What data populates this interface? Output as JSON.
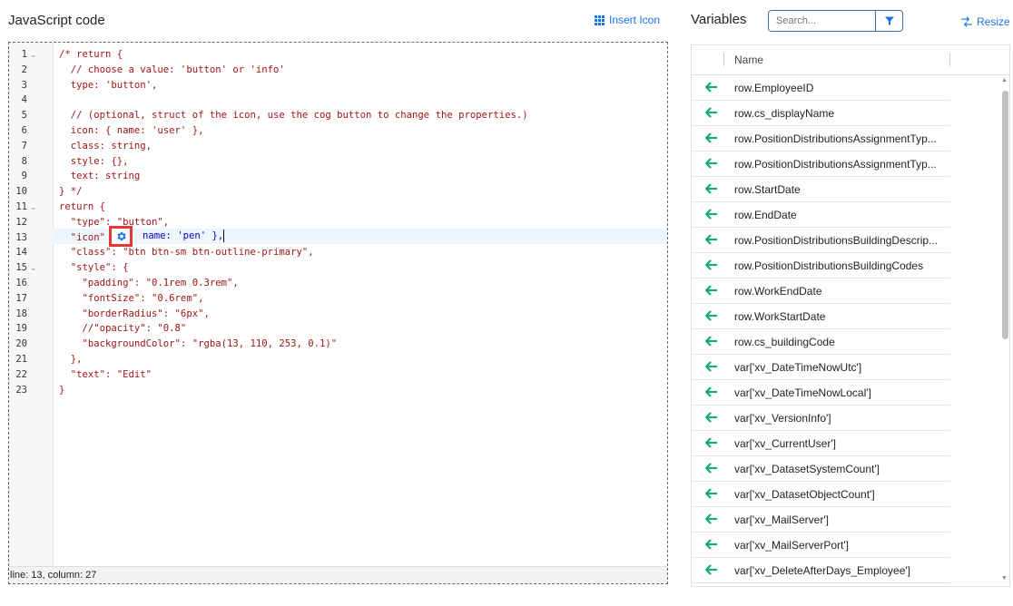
{
  "editor": {
    "title": "JavaScript code",
    "insert_icon_label": "Insert Icon",
    "status": "line: 13, column: 27",
    "line_numbers": [
      "1",
      "2",
      "3",
      "4",
      "5",
      "6",
      "7",
      "8",
      "9",
      "10",
      "11",
      "12",
      "13",
      "14",
      "15",
      "16",
      "17",
      "18",
      "19",
      "20",
      "21",
      "22",
      "23"
    ],
    "code": [
      "/* return {",
      "  // choose a value: 'button' or 'info'",
      "  type: 'button',",
      "",
      "  // (optional, struct of the icon, use the cog button to change the properties.)",
      "  icon: { name: 'user' },",
      "  class: string,",
      "  style: {},",
      "  text: string",
      "} */",
      "return {",
      "  \"type\": \"button\",",
      "  \"icon\"",
      "  \"class\": \"btn btn-sm btn-outline-primary\",",
      "  \"style\": {",
      "    \"padding\": \"0.1rem 0.3rem\",",
      "    \"fontSize\": \"0.6rem\",",
      "    \"borderRadius\": \"6px\",",
      "    //\"opacity\": \"0.8\"",
      "    \"backgroundColor\": \"rgba(13, 110, 253, 0.1)\"",
      "  },",
      "  \"text\": \"Edit\"",
      "}"
    ],
    "line13_tail": "name: 'pen' },"
  },
  "variables": {
    "title": "Variables",
    "search_placeholder": "Search...",
    "resize_label": "Resize",
    "column_name": "Name",
    "items": [
      "row.EmployeeID",
      "row.cs_displayName",
      "row.PositionDistributionsAssignmentTyp...",
      "row.PositionDistributionsAssignmentTyp...",
      "row.StartDate",
      "row.EndDate",
      "row.PositionDistributionsBuildingDescrip...",
      "row.PositionDistributionsBuildingCodes",
      "row.WorkEndDate",
      "row.WorkStartDate",
      "row.cs_buildingCode",
      "var['xv_DateTimeNowUtc']",
      "var['xv_DateTimeNowLocal']",
      "var['xv_VersionInfo']",
      "var['xv_CurrentUser']",
      "var['xv_DatasetSystemCount']",
      "var['xv_DatasetObjectCount']",
      "var['xv_MailServer']",
      "var['xv_MailServerPort']",
      "var['xv_DeleteAfterDays_Employee']"
    ]
  },
  "colors": {
    "accent": "#1a73e8",
    "arrow": "#18a87a",
    "highlight_box": "#e53935",
    "code_text": "#a31515",
    "comment": "#a31515"
  },
  "icons": [
    "grid-icon",
    "filter-icon",
    "resize-icon",
    "cog-icon",
    "arrow-left-icon"
  ]
}
